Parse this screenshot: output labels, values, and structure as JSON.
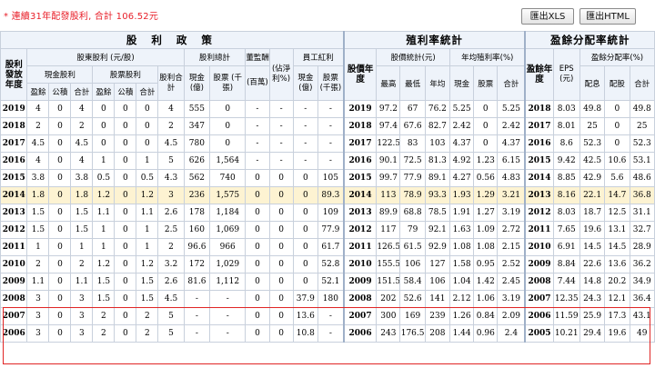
{
  "note": "* 連續31年配發股利, 合計 106.52元",
  "buttons": {
    "xls": "匯出XLS",
    "html": "匯出HTML"
  },
  "headers": {
    "dividend_policy": "股 利 政 策",
    "yield_stats": "殖利率統計",
    "payout_stats": "盈餘分配率統計",
    "dividend_year": "股利發放年度",
    "shareholder_div": "股東股利 (元/股)",
    "cash_div": "現金股利",
    "stock_div": "股票股利",
    "div_total": "股利合計",
    "div_sum_total": "股利總計",
    "director_pay": "董監酬勞",
    "employee_bonus": "員工紅利",
    "net_profit_pct": "(佔淨利%)",
    "price_year": "股價年度",
    "price_stats": "股價統計(元)",
    "avg_yield": "年均殖利率(%)",
    "earn_year": "盈餘年度",
    "eps": "EPS (元)",
    "payout_rate": "盈餘分配率(%)",
    "surplus": "盈餘",
    "reserve": "公積",
    "total": "合計",
    "cash_big": "現金 (億)",
    "stock_k": "股票 (千張)",
    "cash_b": "(百萬)",
    "max": "最高",
    "min": "最低",
    "avg": "年均",
    "cash": "現金",
    "stock": "股票",
    "pay_cash": "配息",
    "pay_stock": "配股"
  },
  "rows": [
    [
      "2019",
      "4",
      "0",
      "4",
      "0",
      "0",
      "0",
      "4",
      "555",
      "0",
      "-",
      "-",
      "-",
      "-",
      "2019",
      "97.2",
      "67",
      "76.2",
      "5.25",
      "0",
      "5.25",
      "2018",
      "8.03",
      "49.8",
      "0",
      "49.8"
    ],
    [
      "2018",
      "2",
      "0",
      "2",
      "0",
      "0",
      "0",
      "2",
      "347",
      "0",
      "-",
      "-",
      "-",
      "-",
      "2018",
      "97.4",
      "67.6",
      "82.7",
      "2.42",
      "0",
      "2.42",
      "2017",
      "8.01",
      "25",
      "0",
      "25"
    ],
    [
      "2017",
      "4.5",
      "0",
      "4.5",
      "0",
      "0",
      "0",
      "4.5",
      "780",
      "0",
      "-",
      "-",
      "-",
      "-",
      "2017",
      "122.5",
      "83",
      "103",
      "4.37",
      "0",
      "4.37",
      "2016",
      "8.6",
      "52.3",
      "0",
      "52.3"
    ],
    [
      "2016",
      "4",
      "0",
      "4",
      "1",
      "0",
      "1",
      "5",
      "626",
      "1,564",
      "-",
      "-",
      "-",
      "-",
      "2016",
      "90.1",
      "72.5",
      "81.3",
      "4.92",
      "1.23",
      "6.15",
      "2015",
      "9.42",
      "42.5",
      "10.6",
      "53.1"
    ],
    [
      "2015",
      "3.8",
      "0",
      "3.8",
      "0.5",
      "0",
      "0.5",
      "4.3",
      "562",
      "740",
      "0",
      "0",
      "0",
      "105",
      "2015",
      "99.7",
      "77.9",
      "89.1",
      "4.27",
      "0.56",
      "4.83",
      "2014",
      "8.85",
      "42.9",
      "5.6",
      "48.6"
    ],
    [
      "2014",
      "1.8",
      "0",
      "1.8",
      "1.2",
      "0",
      "1.2",
      "3",
      "236",
      "1,575",
      "0",
      "0",
      "0",
      "89.3",
      "2014",
      "113",
      "78.9",
      "93.3",
      "1.93",
      "1.29",
      "3.21",
      "2013",
      "8.16",
      "22.1",
      "14.7",
      "36.8"
    ],
    [
      "2013",
      "1.5",
      "0",
      "1.5",
      "1.1",
      "0",
      "1.1",
      "2.6",
      "178",
      "1,184",
      "0",
      "0",
      "0",
      "109",
      "2013",
      "89.9",
      "68.8",
      "78.5",
      "1.91",
      "1.27",
      "3.19",
      "2012",
      "8.03",
      "18.7",
      "12.5",
      "31.1"
    ],
    [
      "2012",
      "1.5",
      "0",
      "1.5",
      "1",
      "0",
      "1",
      "2.5",
      "160",
      "1,069",
      "0",
      "0",
      "0",
      "77.9",
      "2012",
      "117",
      "79",
      "92.1",
      "1.63",
      "1.09",
      "2.72",
      "2011",
      "7.65",
      "19.6",
      "13.1",
      "32.7"
    ],
    [
      "2011",
      "1",
      "0",
      "1",
      "1",
      "0",
      "1",
      "2",
      "96.6",
      "966",
      "0",
      "0",
      "0",
      "61.7",
      "2011",
      "126.5",
      "61.5",
      "92.9",
      "1.08",
      "1.08",
      "2.15",
      "2010",
      "6.91",
      "14.5",
      "14.5",
      "28.9"
    ],
    [
      "2010",
      "2",
      "0",
      "2",
      "1.2",
      "0",
      "1.2",
      "3.2",
      "172",
      "1,029",
      "0",
      "0",
      "0",
      "52.8",
      "2010",
      "155.5",
      "106",
      "127",
      "1.58",
      "0.95",
      "2.52",
      "2009",
      "8.84",
      "22.6",
      "13.6",
      "36.2"
    ],
    [
      "2009",
      "1.1",
      "0",
      "1.1",
      "1.5",
      "0",
      "1.5",
      "2.6",
      "81.6",
      "1,112",
      "0",
      "0",
      "0",
      "52.1",
      "2009",
      "151.5",
      "58.4",
      "106",
      "1.04",
      "1.42",
      "2.45",
      "2008",
      "7.44",
      "14.8",
      "20.2",
      "34.9"
    ],
    [
      "2008",
      "3",
      "0",
      "3",
      "1.5",
      "0",
      "1.5",
      "4.5",
      "-",
      "-",
      "0",
      "0",
      "37.9",
      "180",
      "2008",
      "202",
      "52.6",
      "141",
      "2.12",
      "1.06",
      "3.19",
      "2007",
      "12.35",
      "24.3",
      "12.1",
      "36.4"
    ],
    [
      "2007",
      "3",
      "0",
      "3",
      "2",
      "0",
      "2",
      "5",
      "-",
      "-",
      "0",
      "0",
      "13.6",
      "-",
      "2007",
      "300",
      "169",
      "239",
      "1.26",
      "0.84",
      "2.09",
      "2006",
      "11.59",
      "25.9",
      "17.3",
      "43.1"
    ],
    [
      "2006",
      "3",
      "0",
      "3",
      "2",
      "0",
      "2",
      "5",
      "-",
      "-",
      "0",
      "0",
      "10.8",
      "-",
      "2006",
      "243",
      "176.5",
      "208",
      "1.44",
      "0.96",
      "2.4",
      "2005",
      "10.21",
      "29.4",
      "19.6",
      "49"
    ]
  ]
}
